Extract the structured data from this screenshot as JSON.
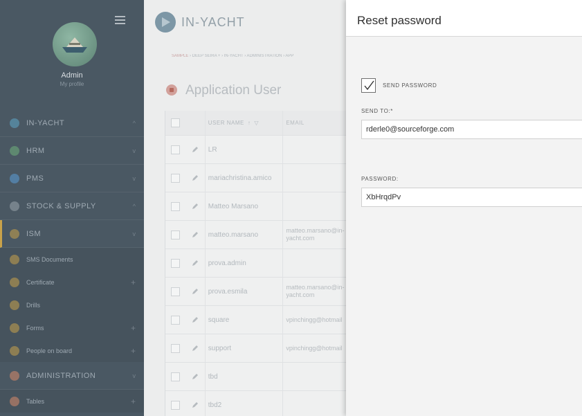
{
  "sidebar": {
    "user_name": "Admin",
    "user_role": "My profile",
    "items": [
      {
        "label": "IN-YACHT",
        "icon": "yacht-icon",
        "color": "#5fa8c9",
        "type": "section",
        "caret": "^"
      },
      {
        "label": "HRM",
        "icon": "people-icon",
        "color": "#6fb07b",
        "type": "section",
        "caret": "v"
      },
      {
        "label": "PMS",
        "icon": "wrench-icon",
        "color": "#5b9fd8",
        "type": "section",
        "caret": "v"
      },
      {
        "label": "STOCK & SUPPLY",
        "icon": "box-icon",
        "color": "#9aa5ad",
        "type": "section",
        "caret": "^"
      },
      {
        "label": "ISM",
        "icon": "shield-icon",
        "color": "#c9a24a",
        "type": "section",
        "caret": "v",
        "active": true
      },
      {
        "label": "SMS Documents",
        "icon": "document-icon",
        "color": "#c9a24a",
        "type": "sub"
      },
      {
        "label": "Certificate",
        "icon": "certificate-icon",
        "color": "#c9a24a",
        "type": "sub",
        "plus": "+"
      },
      {
        "label": "Drills",
        "icon": "drill-icon",
        "color": "#c9a24a",
        "type": "sub"
      },
      {
        "label": "Forms",
        "icon": "form-icon",
        "color": "#c9a24a",
        "type": "sub",
        "plus": "+"
      },
      {
        "label": "People on board",
        "icon": "person-icon",
        "color": "#c9a24a",
        "type": "sub",
        "plus": "+"
      },
      {
        "label": "ADMINISTRATION",
        "icon": "gear-icon",
        "color": "#d98b6a",
        "type": "section",
        "caret": "v"
      },
      {
        "label": "Tables",
        "icon": "table-icon",
        "color": "#d98b6a",
        "type": "sub",
        "plus": "+"
      }
    ]
  },
  "main": {
    "brand": "IN-YACHT",
    "breadcrumb_first": "SAMPLE",
    "breadcrumb_rest": " › DEEP SEIRA + › IN-YACHT › ADMINISTRATION › APP",
    "page_title": "Application User",
    "table": {
      "headers": {
        "user_name": "USER NAME",
        "email": "EMAIL"
      },
      "rows": [
        {
          "user_name": "LR",
          "email": ""
        },
        {
          "user_name": "mariachristina.amico",
          "email": ""
        },
        {
          "user_name": "Matteo Marsano",
          "email": ""
        },
        {
          "user_name": "matteo.marsano",
          "email": "matteo.marsano@in-yacht.com"
        },
        {
          "user_name": "prova.admin",
          "email": ""
        },
        {
          "user_name": "prova.esmila",
          "email": "matteo.marsano@in-yacht.com"
        },
        {
          "user_name": "square",
          "email": "vpinchingg@hotmail"
        },
        {
          "user_name": "support",
          "email": "vpinchingg@hotmail"
        },
        {
          "user_name": "tbd",
          "email": ""
        },
        {
          "user_name": "tbd2",
          "email": ""
        }
      ]
    }
  },
  "panel": {
    "title": "Reset password",
    "send_password_label": "SEND PASSWORD",
    "send_password_checked": true,
    "send_to_label": "SEND TO:*",
    "send_to_value": "rderle0@sourceforge.com",
    "password_label": "PASSWORD:",
    "password_value": "XbHrqdPv"
  }
}
